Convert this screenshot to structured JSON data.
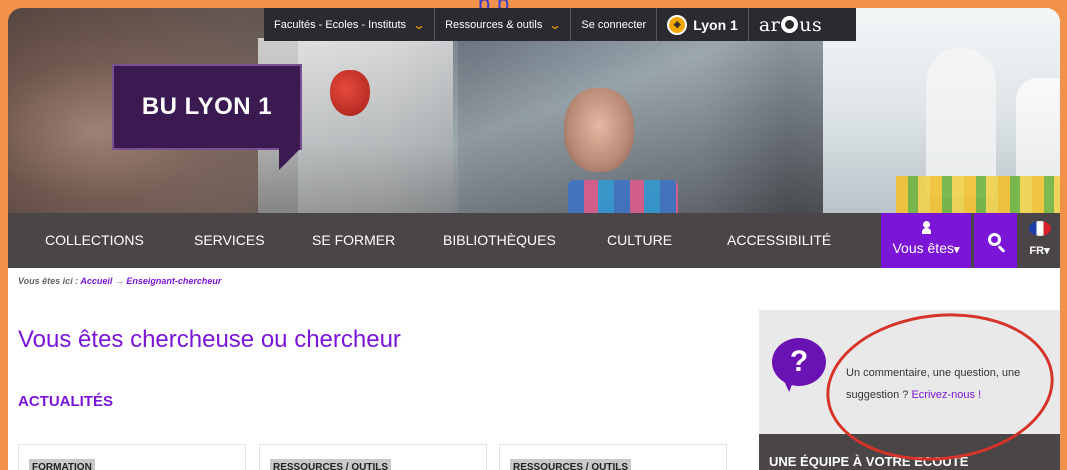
{
  "top_strip": {
    "text": "p  p "
  },
  "topbar": {
    "items": [
      "Facultés - Ecoles - Instituts",
      "Ressources & outils",
      "Se connecter"
    ],
    "lyon1": "Lyon 1",
    "arqus_left": "ar",
    "arqus_right": "us"
  },
  "logo": {
    "text": "BU LYON 1"
  },
  "nav": {
    "items": [
      "COLLECTIONS",
      "SERVICES",
      "SE FORMER",
      "BIBLIOTHÈQUES",
      "CULTURE",
      "ACCESSIBILITÉ"
    ],
    "vous_etes": "Vous êtes",
    "lang": "FR"
  },
  "breadcrumb": {
    "prefix": "Vous êtes ici : ",
    "home": "Accueil",
    "arrow": " → ",
    "current": "Enseignant-chercheur"
  },
  "page": {
    "title": "Vous êtes chercheuse ou chercheur",
    "section": "ACTUALITÉS",
    "cards": [
      "FORMATION",
      "RESSOURCES / OUTILS",
      "RESSOURCES / OUTILS"
    ]
  },
  "sidebar": {
    "question_mark": "?",
    "text": "Un commentaire, une question, une suggestion ? ",
    "link": "Ecrivez-nous !",
    "team_heading": "UNE ÉQUIPE À VOTRE ECOUTE"
  },
  "colors": {
    "accent": "#7b16d6",
    "dark": "#4a4547",
    "annotation": "#d6332a",
    "background": "#f2914a"
  },
  "icons": {
    "user": "user-icon",
    "search": "search-icon",
    "flag": "french-flag-icon",
    "chevron": "chevron-down-icon",
    "question": "question-bubble-icon"
  }
}
